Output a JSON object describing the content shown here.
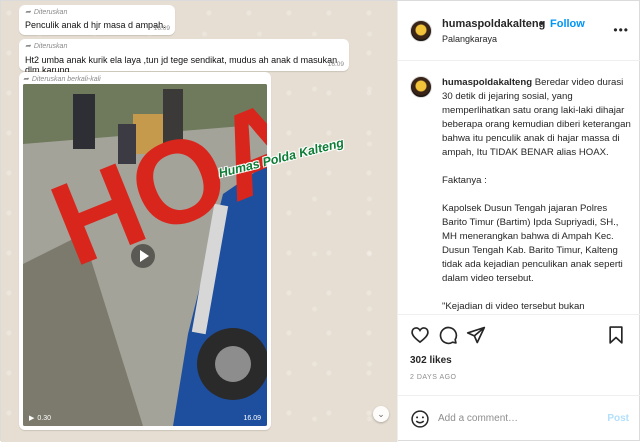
{
  "chat": {
    "forwarded_label": "Diteruskan",
    "forwarded_many_label": "Diteruskan berkali-kali",
    "msg1": {
      "text": "Penculik anak d hjr masa d ampah.",
      "time": "16.09"
    },
    "msg2": {
      "text": "Ht2 umba anak kurik ela laya ,tun jd tege sendikat,  mudus ah anak d masukan dlm karung,",
      "time": "16.09"
    },
    "video": {
      "duration": "0.30",
      "time": "16.09"
    },
    "stamp_text": "HOAX",
    "watermark_text": "Humas Polda Kalteng"
  },
  "header": {
    "username": "humaspoldakalteng",
    "separator": "•",
    "follow_label": "Follow",
    "location": "Palangkaraya",
    "more_icon": "more-horizontal-icon"
  },
  "caption": {
    "username": "humaspoldakalteng",
    "p1": "Beredar video durasi 30 detik di jejaring sosial, yang memperlihatkan satu orang laki-laki dihajar beberapa orang kemudian diberi keterangan bahwa itu penculik anak di hajar massa di ampah, Itu TIDAK BENAR alias HOAX.",
    "p2": "Faktanya :",
    "p3": "Kapolsek Dusun Tengah jajaran Polres Barito Timur (Bartim) Ipda Supriyadi, SH., MH menerangkan bahwa di Ampah Kec. Dusun Tengah Kab. Barito Timur, Kalteng tidak ada kejadian penculikan anak seperti dalam video tersebut.",
    "p4": "\"Kejadian di video tersebut bukan"
  },
  "actions": {
    "likes": "302 likes",
    "time_ago": "2 DAYS AGO",
    "comment_placeholder": "Add a comment…",
    "post_label": "Post"
  },
  "colors": {
    "follow": "#0095f6",
    "hoax": "#d9261c",
    "watermark": "#0d7c35"
  }
}
